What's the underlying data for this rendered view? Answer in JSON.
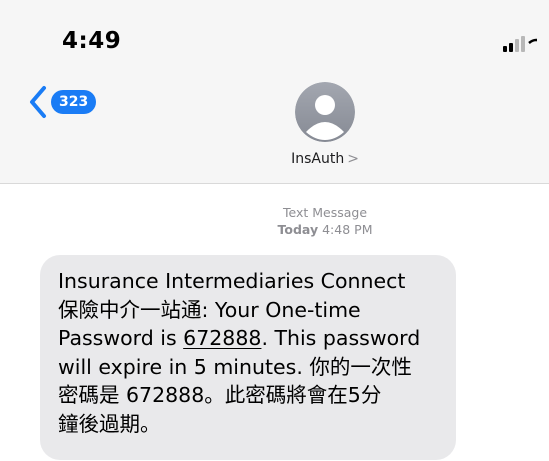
{
  "status_bar": {
    "time": "4:49"
  },
  "header": {
    "back_count": "323",
    "contact_name": "InsAuth",
    "contact_chevron": ">"
  },
  "thread": {
    "meta_type": "Text Message",
    "meta_day": "Today",
    "meta_time": "4:48 PM"
  },
  "message": {
    "line1": "Insurance Intermediaries Connect",
    "line2": "保險中介一站通: Your One-time",
    "line3_pre": "Password is ",
    "otp": "672888",
    "line3_post": ". This password",
    "line4": "will expire in 5 minutes. 你的一次性",
    "line5": "密碼是 672888。此密碼將會在5分",
    "line6": "鐘後過期。"
  },
  "colors": {
    "accent": "#1a7cf5",
    "bubble": "#e9e9eb",
    "header_bg": "#f6f6f6"
  }
}
